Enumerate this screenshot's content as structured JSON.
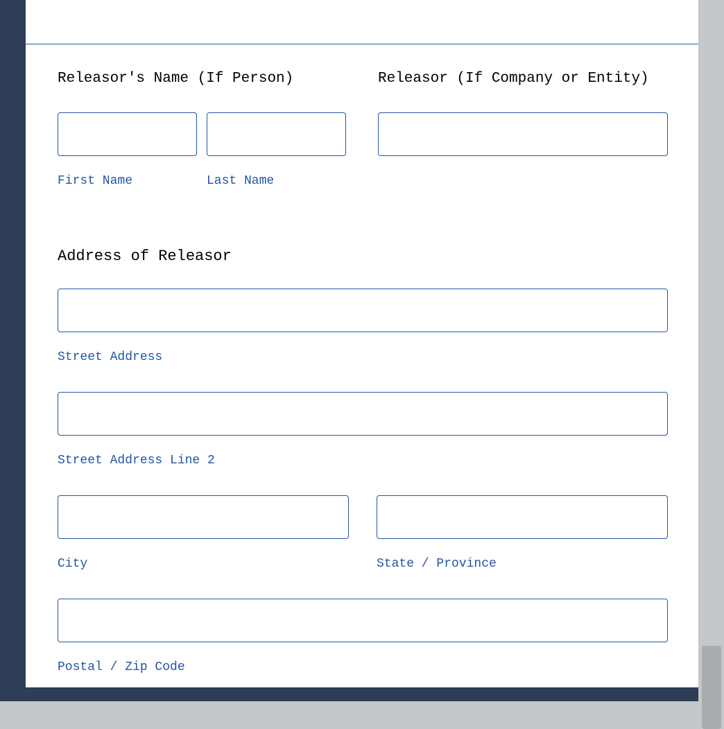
{
  "releasor_person": {
    "label": "Releasor's Name (If Person)",
    "first_name_sub": "First Name",
    "last_name_sub": "Last Name"
  },
  "releasor_entity": {
    "label": "Releasor (If Company or Entity)"
  },
  "address": {
    "title": "Address of Releasor",
    "street_sub": "Street Address",
    "street2_sub": "Street Address Line 2",
    "city_sub": "City",
    "state_sub": "State / Province",
    "postal_sub": "Postal / Zip Code"
  }
}
